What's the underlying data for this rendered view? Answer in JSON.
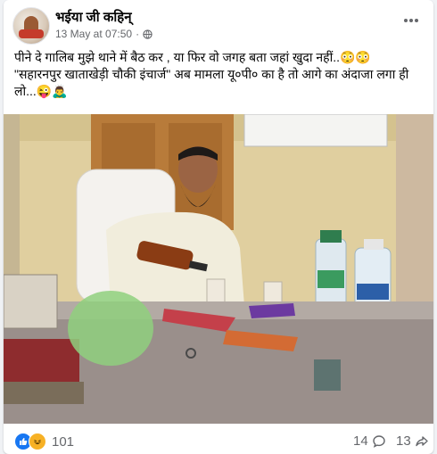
{
  "post": {
    "page_name": "भईया जी कहिन्",
    "date": "13 May at 07:50",
    "separator": "·",
    "privacy_icon": "globe-icon",
    "caption_lines": [
      "पीने दे गालिब मुझे थाने में बैठ कर , या फिर वो जगह बता जहां खुदा नहीं..😳😳",
      "\"सहारनपुर खाताखेड़ी चौकी इंचार्ज\" अब मामला यू०पी० का है तो आगे का अंदाजा लगा ही लो...😜🙇‍♂️"
    ]
  },
  "stats": {
    "reaction_icons": [
      "like-icon",
      "haha-icon"
    ],
    "reactions_count": "101",
    "comments_count": "14",
    "shares_count": "13"
  },
  "colors": {
    "like_blue": "#1877f2",
    "haha_yellow": "#f7b125",
    "text_secondary": "#65676b"
  }
}
